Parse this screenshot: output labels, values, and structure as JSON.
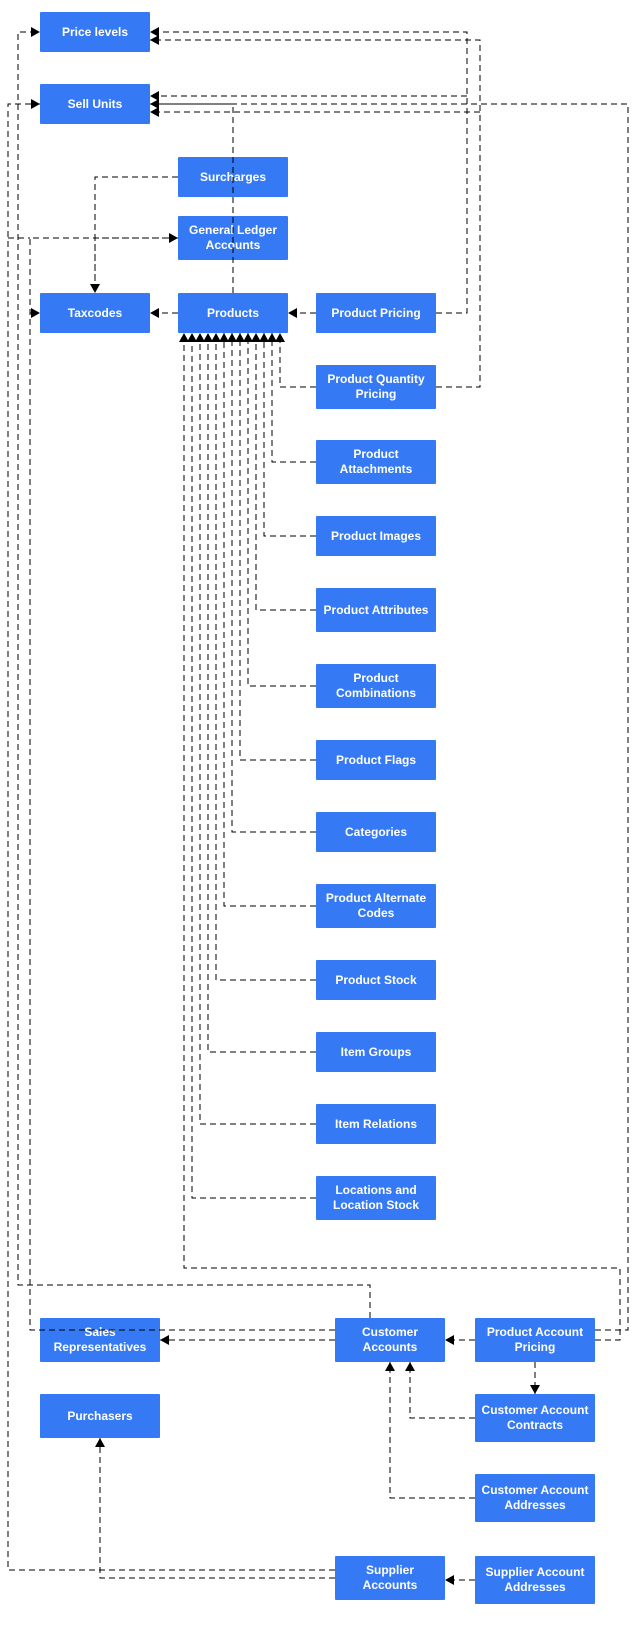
{
  "nodes": {
    "price_levels": "Price levels",
    "sell_units": "Sell Units",
    "surcharges": "Surcharges",
    "gl_accounts": "General Ledger Accounts",
    "taxcodes": "Taxcodes",
    "products": "Products",
    "product_pricing": "Product Pricing",
    "product_qty_pricing": "Product Quantity Pricing",
    "product_attachments": "Product Attachments",
    "product_images": "Product Images",
    "product_attributes": "Product Attributes",
    "product_combinations": "Product Combinations",
    "product_flags": "Product Flags",
    "categories": "Categories",
    "product_alt_codes": "Product Alternate Codes",
    "product_stock": "Product Stock",
    "item_groups": "Item Groups",
    "item_relations": "Item Relations",
    "locations_stock": "Locations and Location Stock",
    "sales_reps": "Sales Representatives",
    "customer_accounts": "Customer Accounts",
    "product_account_pricing": "Product Account Pricing",
    "customer_contracts": "Customer Account Contracts",
    "customer_addresses": "Customer Account Addresses",
    "purchasers": "Purchasers",
    "supplier_accounts": "Supplier Accounts",
    "supplier_addresses": "Supplier Account Addresses"
  },
  "colors": {
    "node_bg": "#3679f5",
    "node_fg": "#ffffff",
    "connector": "#000000"
  }
}
